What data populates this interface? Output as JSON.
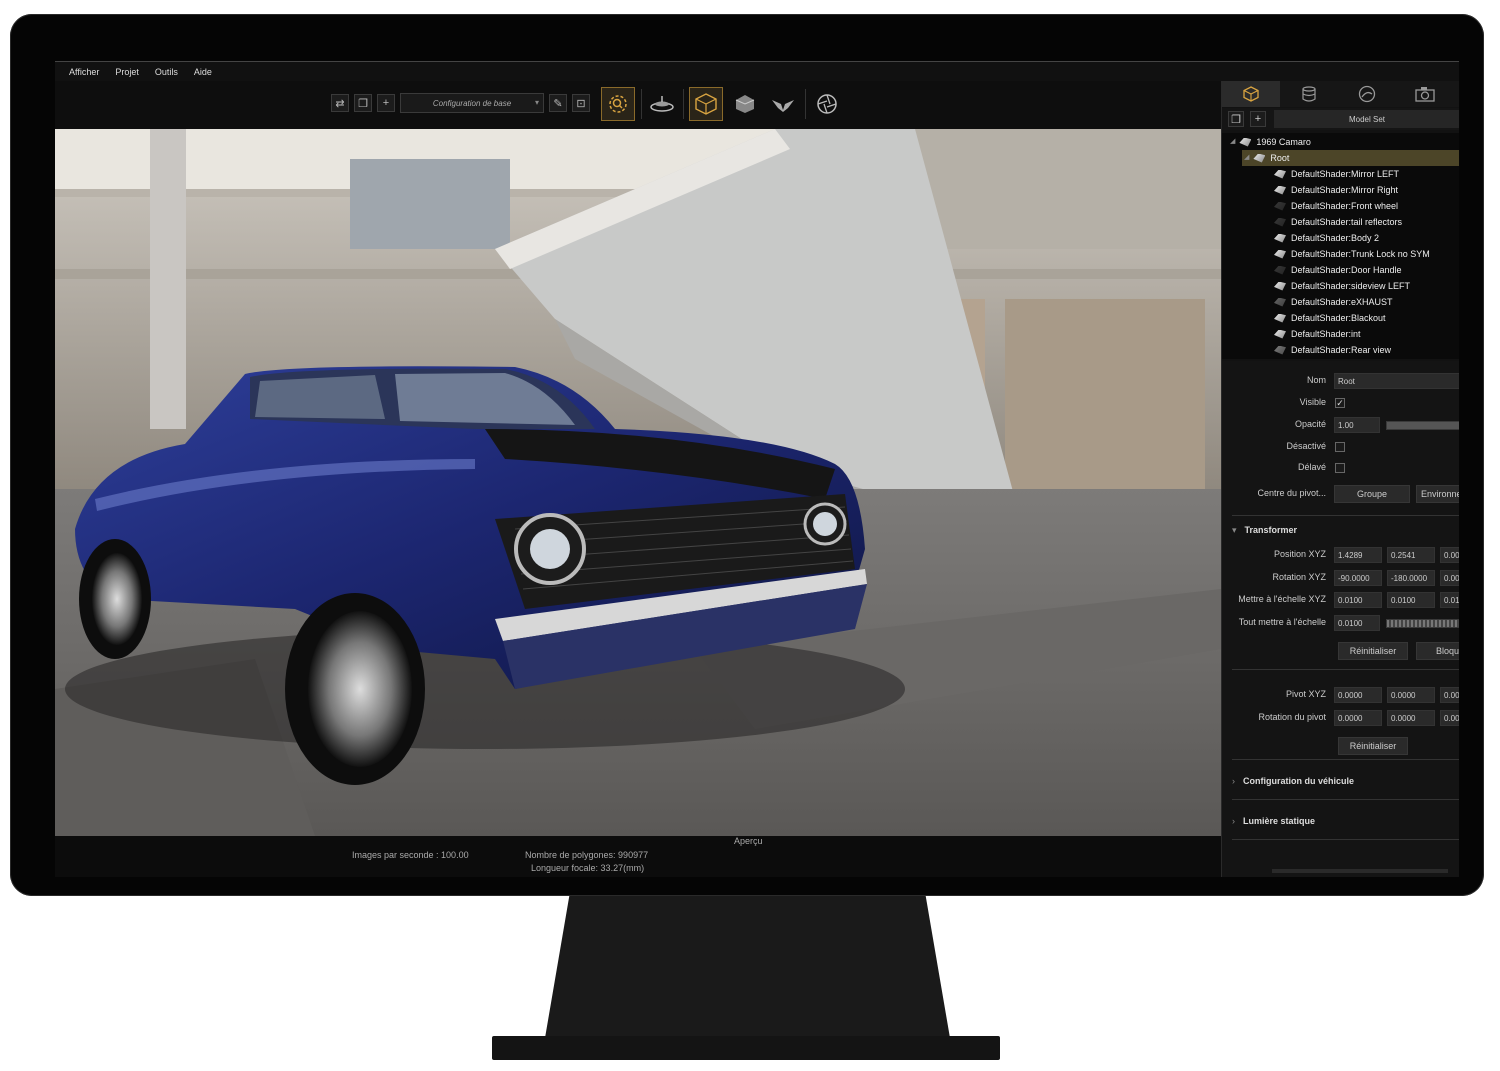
{
  "menubar": {
    "items": [
      "Afficher",
      "Projet",
      "Outils",
      "Aide"
    ]
  },
  "toolbar": {
    "configuration": "Configuration de base",
    "icons": [
      "swap-icon",
      "duplicate-icon",
      "add-icon",
      "edit-icon",
      "lock-icon",
      "search-zoom-icon",
      "turntable-icon",
      "box-icon",
      "solid-icon",
      "wings-icon",
      "aperture-icon"
    ]
  },
  "status": {
    "fps": "Images par seconde : 100.00",
    "polygons": "Nombre de polygones: 990977",
    "focal": "Longueur focale: 33.27(mm)",
    "mode": "Aperçu"
  },
  "panel": {
    "tabs": [
      "cube-icon",
      "database-icon",
      "gauge-icon",
      "camera-icon"
    ],
    "modelset": "Model Set",
    "tree": [
      {
        "label": "1969 Camaro",
        "level": 0
      },
      {
        "label": "Root",
        "level": 1
      },
      {
        "label": "DefaultShader:Mirror LEFT",
        "level": 2
      },
      {
        "label": "DefaultShader:Mirror Right",
        "level": 2
      },
      {
        "label": "DefaultShader:Front wheel",
        "level": 2
      },
      {
        "label": "DefaultShader:tail reflectors",
        "level": 2
      },
      {
        "label": "DefaultShader:Body 2",
        "level": 2
      },
      {
        "label": "DefaultShader:Trunk Lock no SYM",
        "level": 2
      },
      {
        "label": "DefaultShader:Door Handle",
        "level": 2
      },
      {
        "label": "DefaultShader:sideview LEFT",
        "level": 2
      },
      {
        "label": "DefaultShader:eXHAUST",
        "level": 2
      },
      {
        "label": "DefaultShader:Blackout",
        "level": 2
      },
      {
        "label": "DefaultShader:int",
        "level": 2
      },
      {
        "label": "DefaultShader:Rear view",
        "level": 2
      }
    ],
    "props": {
      "nom_label": "Nom",
      "nom_value": "Root",
      "visible_label": "Visible",
      "visible_checked": "✓",
      "opacite_label": "Opacité",
      "opacite_value": "1.00",
      "desactive_label": "Désactivé",
      "delave_label": "Délavé",
      "pivot_center_label": "Centre du pivot...",
      "groupe_button": "Groupe",
      "environnement_button": "Environne"
    },
    "transform": {
      "title": "Transformer",
      "position_label": "Position XYZ",
      "position": [
        "1.4289",
        "0.2541",
        "0.00"
      ],
      "rotation_label": "Rotation XYZ",
      "rotation": [
        "-90.0000",
        "-180.0000",
        "0.00"
      ],
      "scale_label": "Mettre à l'échelle XYZ",
      "scale": [
        "0.0100",
        "0.0100",
        "0.01"
      ],
      "uniform_label": "Tout mettre à l'échelle",
      "uniform": "0.0100",
      "reset_button": "Réinitialiser",
      "lock_button": "Bloqu",
      "pivot_label": "Pivot XYZ",
      "pivot": [
        "0.0000",
        "0.0000",
        "0.00"
      ],
      "pivot_rot_label": "Rotation du pivot",
      "pivot_rot": [
        "0.0000",
        "0.0000",
        "0.00"
      ],
      "reset2_button": "Réinitialiser"
    },
    "sections": [
      "Configuration du véhicule",
      "Lumière statique"
    ]
  },
  "colors": {
    "accent": "#d9a441",
    "car": "#1f2d7a",
    "background": "#0d0d0d"
  }
}
